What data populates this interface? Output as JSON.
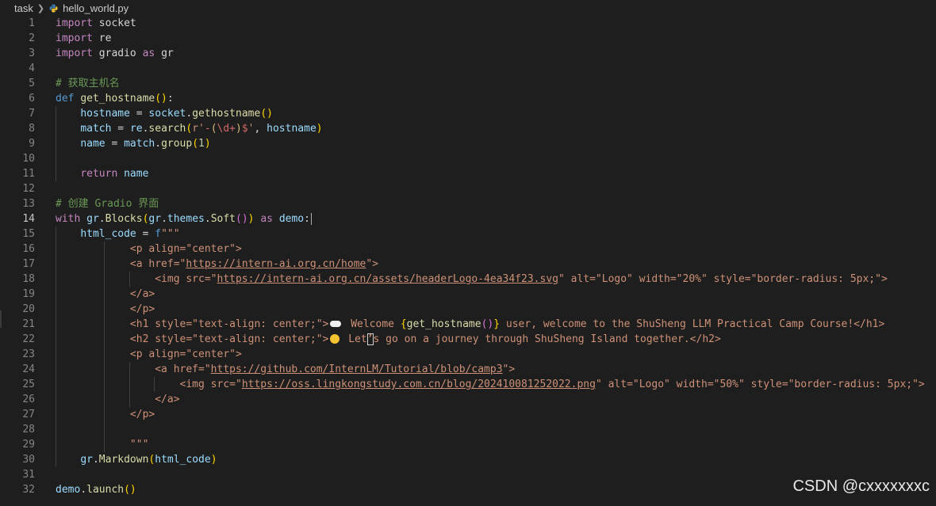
{
  "breadcrumb": {
    "folder": "task",
    "file": "hello_world.py"
  },
  "editor": {
    "active_line": 14,
    "lines": [
      {
        "n": "1",
        "tokens": [
          {
            "t": "import",
            "c": "kw-ctrl"
          },
          {
            "t": " socket",
            "c": ""
          }
        ]
      },
      {
        "n": "2",
        "tokens": [
          {
            "t": "import",
            "c": "kw-ctrl"
          },
          {
            "t": " re",
            "c": ""
          }
        ]
      },
      {
        "n": "3",
        "tokens": [
          {
            "t": "import",
            "c": "kw-ctrl"
          },
          {
            "t": " gradio ",
            "c": ""
          },
          {
            "t": "as",
            "c": "kw-ctrl"
          },
          {
            "t": " gr",
            "c": ""
          }
        ]
      },
      {
        "n": "4",
        "tokens": []
      },
      {
        "n": "5",
        "tokens": [
          {
            "t": "# 获取主机名",
            "c": "cm"
          }
        ]
      },
      {
        "n": "6",
        "tokens": [
          {
            "t": "def",
            "c": "kw"
          },
          {
            "t": " ",
            "c": ""
          },
          {
            "t": "get_hostname",
            "c": "fn"
          },
          {
            "t": "()",
            "c": "br1"
          },
          {
            "t": ":",
            "c": ""
          }
        ]
      },
      {
        "n": "7",
        "guides": [
          70
        ],
        "tokens": [
          {
            "t": "    ",
            "c": ""
          },
          {
            "t": "hostname",
            "c": "var"
          },
          {
            "t": " = ",
            "c": ""
          },
          {
            "t": "socket",
            "c": "var"
          },
          {
            "t": ".",
            "c": ""
          },
          {
            "t": "gethostname",
            "c": "fn"
          },
          {
            "t": "()",
            "c": "br1"
          }
        ]
      },
      {
        "n": "8",
        "guides": [
          70
        ],
        "tokens": [
          {
            "t": "    ",
            "c": ""
          },
          {
            "t": "match",
            "c": "var"
          },
          {
            "t": " = ",
            "c": ""
          },
          {
            "t": "re",
            "c": "var"
          },
          {
            "t": ".",
            "c": ""
          },
          {
            "t": "search",
            "c": "fn"
          },
          {
            "t": "(",
            "c": "br1"
          },
          {
            "t": "r'",
            "c": "str"
          },
          {
            "t": "-",
            "c": "rx"
          },
          {
            "t": "(",
            "c": "esc"
          },
          {
            "t": "\\d+",
            "c": "rx"
          },
          {
            "t": ")",
            "c": "esc"
          },
          {
            "t": "$",
            "c": "rx"
          },
          {
            "t": "'",
            "c": "str"
          },
          {
            "t": ", ",
            "c": ""
          },
          {
            "t": "hostname",
            "c": "var"
          },
          {
            "t": ")",
            "c": "br1"
          }
        ]
      },
      {
        "n": "9",
        "guides": [
          70
        ],
        "tokens": [
          {
            "t": "    ",
            "c": ""
          },
          {
            "t": "name",
            "c": "var"
          },
          {
            "t": " = ",
            "c": ""
          },
          {
            "t": "match",
            "c": "var"
          },
          {
            "t": ".",
            "c": ""
          },
          {
            "t": "group",
            "c": "fn"
          },
          {
            "t": "(",
            "c": "br1"
          },
          {
            "t": "1",
            "c": "num"
          },
          {
            "t": ")",
            "c": "br1"
          }
        ]
      },
      {
        "n": "10",
        "guides": [
          70
        ],
        "tokens": []
      },
      {
        "n": "11",
        "guides": [
          70
        ],
        "tokens": [
          {
            "t": "    ",
            "c": ""
          },
          {
            "t": "return",
            "c": "kw-ctrl"
          },
          {
            "t": " name",
            "c": "var"
          }
        ]
      },
      {
        "n": "12",
        "tokens": []
      },
      {
        "n": "13",
        "tokens": [
          {
            "t": "# 创建 Gradio 界面",
            "c": "cm"
          }
        ]
      },
      {
        "n": "14",
        "cursor": true,
        "tokens": [
          {
            "t": "with",
            "c": "kw-ctrl"
          },
          {
            "t": " ",
            "c": ""
          },
          {
            "t": "gr",
            "c": "var"
          },
          {
            "t": ".",
            "c": ""
          },
          {
            "t": "Blocks",
            "c": "fn"
          },
          {
            "t": "(",
            "c": "br1"
          },
          {
            "t": "gr",
            "c": "var"
          },
          {
            "t": ".",
            "c": ""
          },
          {
            "t": "themes",
            "c": "var"
          },
          {
            "t": ".",
            "c": ""
          },
          {
            "t": "Soft",
            "c": "fn"
          },
          {
            "t": "()",
            "c": "br2"
          },
          {
            "t": ")",
            "c": "br1"
          },
          {
            "t": " ",
            "c": ""
          },
          {
            "t": "as",
            "c": "kw-ctrl"
          },
          {
            "t": " ",
            "c": ""
          },
          {
            "t": "demo",
            "c": "var"
          },
          {
            "t": ":",
            "c": ""
          }
        ]
      },
      {
        "n": "15",
        "guides": [
          70
        ],
        "tokens": [
          {
            "t": "    ",
            "c": ""
          },
          {
            "t": "html_code",
            "c": "var"
          },
          {
            "t": " = ",
            "c": ""
          },
          {
            "t": "f",
            "c": "kw"
          },
          {
            "t": "\"\"\"",
            "c": "str"
          }
        ]
      },
      {
        "n": "16",
        "guides": [
          70,
          131
        ],
        "tokens": [
          {
            "t": "            <p align=\"center\">",
            "c": "str"
          }
        ]
      },
      {
        "n": "17",
        "guides": [
          70,
          131
        ],
        "tokens": [
          {
            "t": "            <a href=\"",
            "c": "str"
          },
          {
            "t": "https://intern-ai.org.cn/home",
            "c": "lnk"
          },
          {
            "t": "\">",
            "c": "str"
          }
        ]
      },
      {
        "n": "18",
        "guides": [
          70,
          131,
          163
        ],
        "tokens": [
          {
            "t": "                <img src=\"",
            "c": "str"
          },
          {
            "t": "https://intern-ai.org.cn/assets/headerLogo-4ea34f23.svg",
            "c": "lnk"
          },
          {
            "t": "\" alt=\"Logo\" width=\"20%\" style=\"border-radius: 5px;\">",
            "c": "str"
          }
        ]
      },
      {
        "n": "19",
        "guides": [
          70,
          131
        ],
        "tokens": [
          {
            "t": "            </a>",
            "c": "str"
          }
        ]
      },
      {
        "n": "20",
        "guides": [
          70,
          131
        ],
        "tokens": [
          {
            "t": "            </p>",
            "c": "str"
          }
        ]
      },
      {
        "n": "21",
        "guides": [
          70,
          131
        ],
        "tokens": [
          {
            "t": "            <h1 style=\"text-align: center;\">",
            "c": "str"
          },
          {
            "t": "",
            "c": "cloud"
          },
          {
            "t": " Welcome ",
            "c": "str"
          },
          {
            "t": "{",
            "c": "br1"
          },
          {
            "t": "get_hostname",
            "c": "fn"
          },
          {
            "t": "()",
            "c": "br2"
          },
          {
            "t": "}",
            "c": "br1"
          },
          {
            "t": " user, welcome to the ShuSheng LLM Practical Camp Course!</h1>",
            "c": "str"
          }
        ]
      },
      {
        "n": "22",
        "guides": [
          70,
          131
        ],
        "tokens": [
          {
            "t": "            <h2 style=\"text-align: center;\">",
            "c": "str"
          },
          {
            "t": "",
            "c": "smile"
          },
          {
            "t": " Let",
            "c": "str"
          },
          {
            "t": "’",
            "c": "boxch str"
          },
          {
            "t": "s go on a journey through ShuSheng Island together.</h2>",
            "c": "str"
          }
        ]
      },
      {
        "n": "23",
        "guides": [
          70,
          131
        ],
        "tokens": [
          {
            "t": "            <p align=\"center\">",
            "c": "str"
          }
        ]
      },
      {
        "n": "24",
        "guides": [
          70,
          131,
          163
        ],
        "tokens": [
          {
            "t": "                <a href=\"",
            "c": "str"
          },
          {
            "t": "https://github.com/InternLM/Tutorial/blob/camp3",
            "c": "lnk"
          },
          {
            "t": "\">",
            "c": "str"
          }
        ]
      },
      {
        "n": "25",
        "guides": [
          70,
          131,
          163,
          194
        ],
        "tokens": [
          {
            "t": "                    <img src=\"",
            "c": "str"
          },
          {
            "t": "https://oss.lingkongstudy.com.cn/blog/202410081252022.png",
            "c": "lnk"
          },
          {
            "t": "\" alt=\"Logo\" width=\"50%\" style=\"border-radius: 5px;\">",
            "c": "str"
          }
        ]
      },
      {
        "n": "26",
        "guides": [
          70,
          131,
          163
        ],
        "tokens": [
          {
            "t": "                </a>",
            "c": "str"
          }
        ]
      },
      {
        "n": "27",
        "guides": [
          70,
          131
        ],
        "tokens": [
          {
            "t": "            </p>",
            "c": "str"
          }
        ]
      },
      {
        "n": "28",
        "guides": [
          70,
          131
        ],
        "tokens": []
      },
      {
        "n": "29",
        "guides": [
          70,
          131
        ],
        "tokens": [
          {
            "t": "            \"\"\"",
            "c": "str"
          }
        ]
      },
      {
        "n": "30",
        "guides": [
          70
        ],
        "tokens": [
          {
            "t": "    ",
            "c": ""
          },
          {
            "t": "gr",
            "c": "var"
          },
          {
            "t": ".",
            "c": ""
          },
          {
            "t": "Markdown",
            "c": "fn"
          },
          {
            "t": "(",
            "c": "br1"
          },
          {
            "t": "html_code",
            "c": "var"
          },
          {
            "t": ")",
            "c": "br1"
          }
        ]
      },
      {
        "n": "31",
        "tokens": []
      },
      {
        "n": "32",
        "tokens": [
          {
            "t": "demo",
            "c": "var"
          },
          {
            "t": ".",
            "c": ""
          },
          {
            "t": "launch",
            "c": "fn"
          },
          {
            "t": "()",
            "c": "br1"
          }
        ]
      }
    ]
  },
  "watermark": "CSDN @cxxxxxxxc",
  "icons": {
    "file_type": "python-file-icon",
    "chevron": "chevron-right-icon"
  }
}
